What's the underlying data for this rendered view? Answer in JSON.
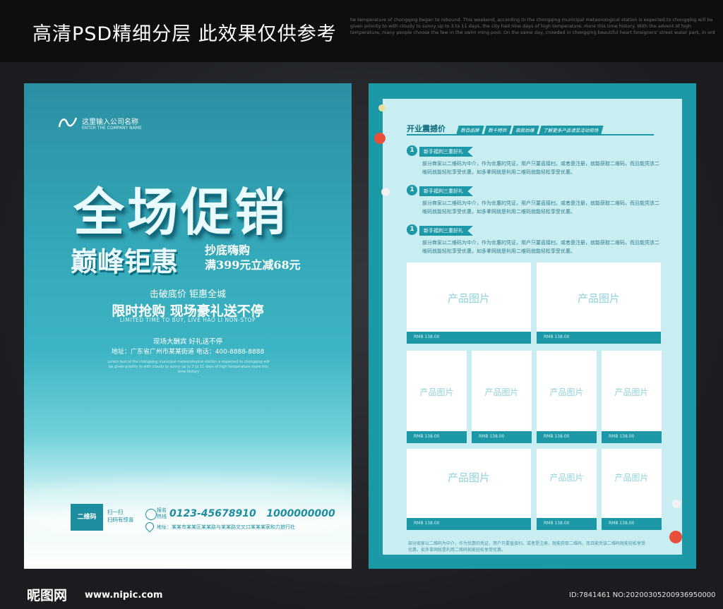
{
  "header": {
    "title": "高清PSD精细分层 此效果仅供参考",
    "english_text": "he temperature of chongqing began to rebound. This weekend, according to the chongqing municipal meteorological station is expected to chongqing will be given priority to with cloudy to sunny up to 3 to 11 days, the city had nine days of high temperature, more this time history. With the advent of high temperature, many people choose the few in the swim ming pool. On the same day, crowded in chongqing beautiful heart foreigners' street water park, in ord"
  },
  "left_poster": {
    "company_name": "这里输入公司名称",
    "company_en": "ENTER THE COMPANY NAME",
    "main_title": "全场促销",
    "subtitle": "巅峰钜惠",
    "promo_line1": "抄底嗨购",
    "promo_line2": "满399元立减68元",
    "slogan1": "击破底价 钜惠全城",
    "slogan2": "限时抢购 现场豪礼送不停",
    "slogan_en": "LIMITED TIME TO BUY, LIVE HAO LI NON-STOP",
    "event": "现场大酬宾 好礼送不停",
    "address_line": "地址：广东省广州市某某街道 电话：400-8888-8888",
    "fine_print": "Lorem text of the chongqing municipal meteorological station is expected to chongqing will be given priority to with cloudy to sunny up to 3 to 11 days of high temperature more this time history",
    "qr_label": "二维码",
    "scan_line1": "扫一扫",
    "scan_line2": "扫码有惊喜",
    "hotline_label_1": "报名",
    "hotline_label_2": "热线",
    "phone1": "0123-45678910",
    "phone2": "1000000000",
    "footer_address": "地址：某某市某某区某某路与某某路交叉口某某某家和力旅行社"
  },
  "right_poster": {
    "section_title": "开业震撼价",
    "tags": [
      "数百品牌",
      "数千特供",
      "款款劲爆",
      "了解更多产品请至活动现场"
    ],
    "items": [
      {
        "num": "1",
        "ribbon": "新手福利三重好礼",
        "desc": "部分商家以二维码为中介，作为优惠的凭证，用户只要直接扫，或者是注册，就能获取二维码，而且能凭该二维码就能轻松享受优惠，如多拿网就是利用二维码就能轻松享受优惠。"
      },
      {
        "num": "1",
        "ribbon": "新手福利三重好礼",
        "desc": "部分商家以二维码为中介，作为优惠的凭证，用户只要直接扫，或者是注册，就能获取二维码，而且能凭该二维码就能轻松享受优惠，如多拿网就是利用二维码就能轻松享受优惠。"
      },
      {
        "num": "1",
        "ribbon": "新手福利三重好礼",
        "desc": "部分商家以二维码为中介，作为优惠的凭证，用户只要直接扫，或者是注册，就能获取二维码，而且能凭该二维码就能轻松享受优惠，如多拿网就是利用二维码就能轻松享受优惠。"
      }
    ],
    "product_label": "产品图片",
    "price_label": "RMB 138.00",
    "footer": "部分商家以二维码为中介，作为优惠的凭证，用户只要直接扫，或者是注册，就能获取二维码，而且能凭该二维码就能轻松享受优惠，如多拿网就是利用二维码就能轻松享受优惠。"
  },
  "watermark": {
    "logo": "昵图网",
    "url": "www.nipic.com",
    "id": "ID:7841461 NO:20200305200936950000"
  },
  "colors": {
    "accent": "#1c98a6",
    "light": "#c9eef2",
    "topbar": "#0e0e10"
  }
}
